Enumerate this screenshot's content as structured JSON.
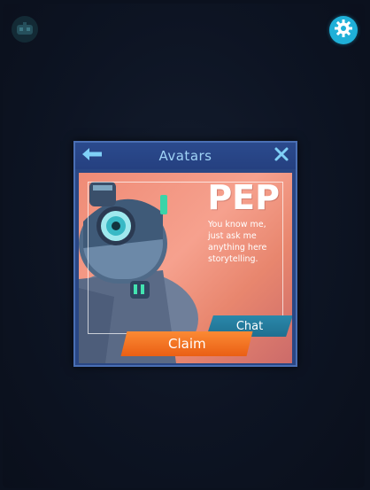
{
  "colors": {
    "background": "#0b111e",
    "modal_bg": "#2a4784",
    "title_text": "#9fd3f6",
    "settings_accent": "#1fb0d8",
    "card_peach": "#f6a18e",
    "chat_teal": "#1f6f90",
    "claim_orange": "#ea5f14"
  },
  "icons": {
    "top_left": "robot-head-icon",
    "settings": "gear-icon",
    "back": "arrow-left-icon",
    "close": "close-icon"
  },
  "modal": {
    "title": "Avatars"
  },
  "avatar": {
    "name": "PEP",
    "description_lines": [
      "You know me,",
      "just ask me",
      "anything here",
      "storytelling."
    ]
  },
  "buttons": {
    "chat": "Chat",
    "claim": "Claim"
  }
}
